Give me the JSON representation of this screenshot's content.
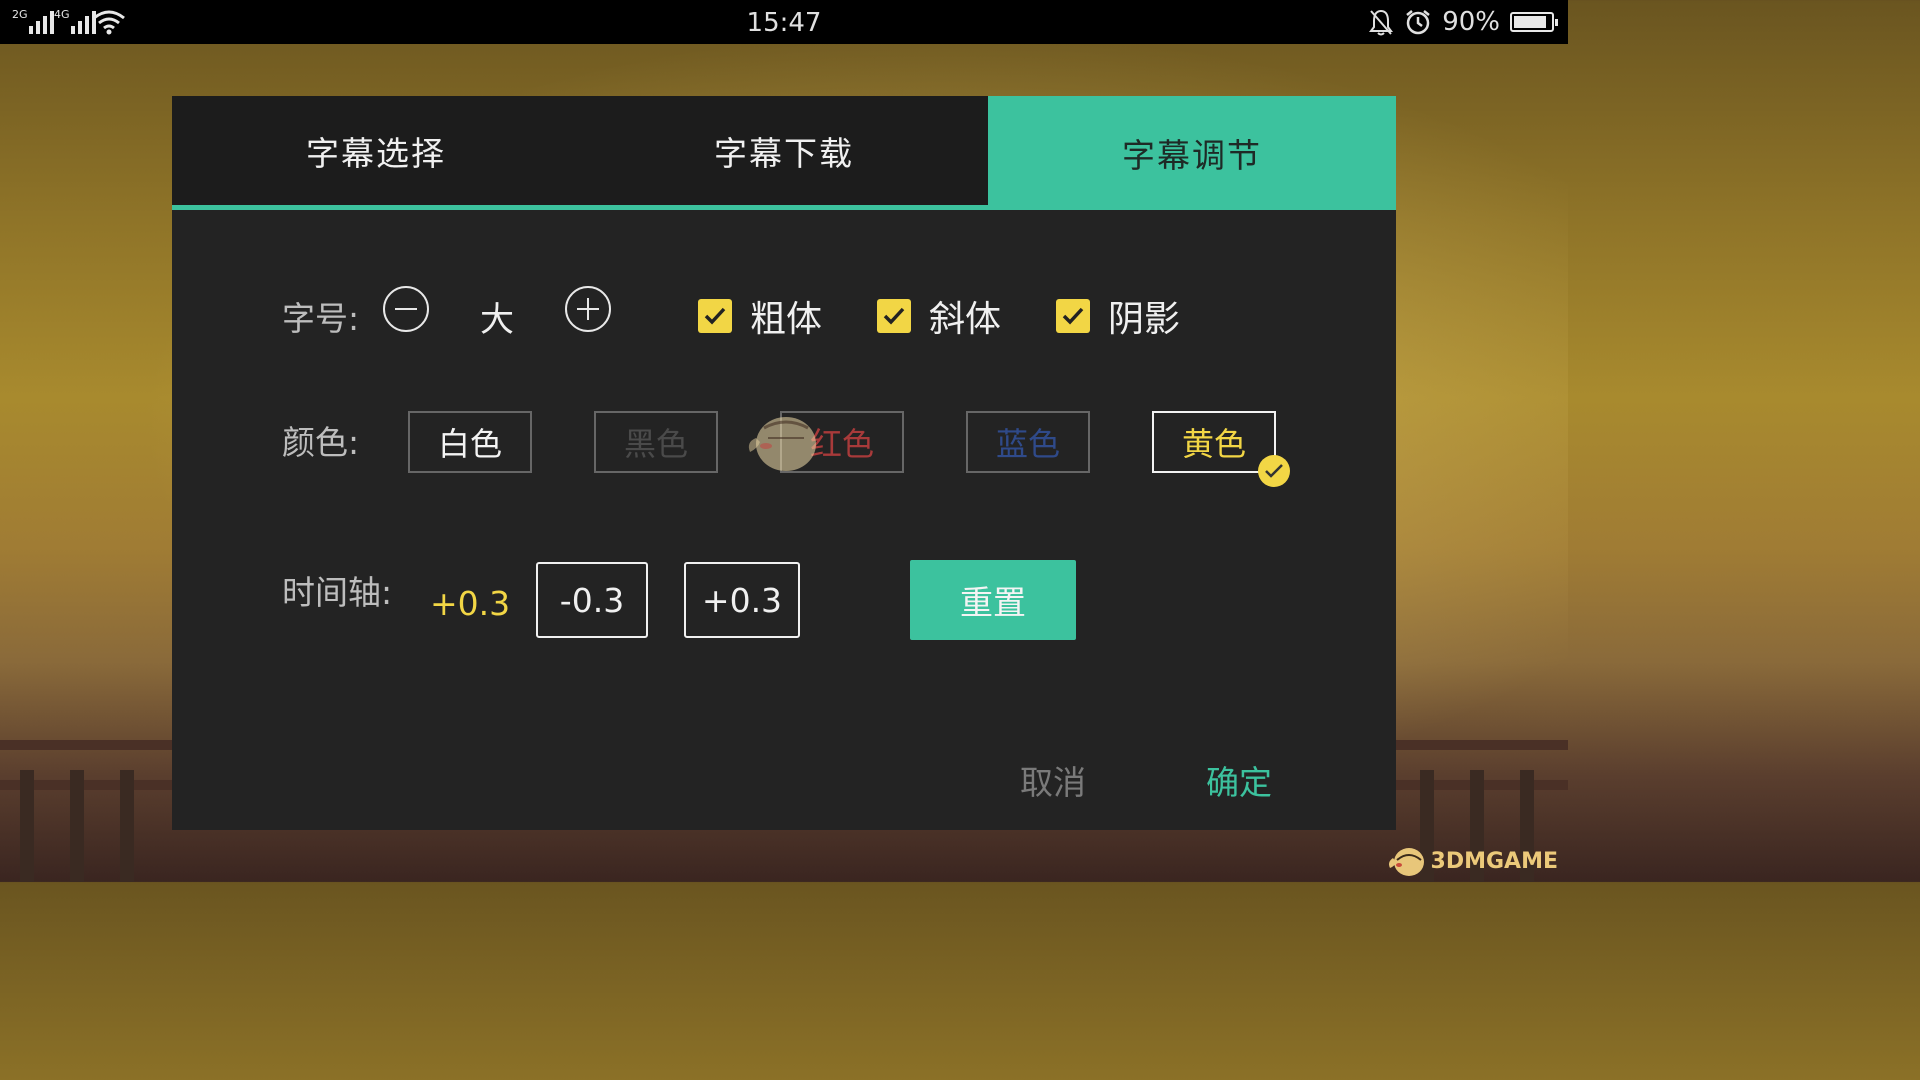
{
  "status_bar": {
    "network_1": "2G",
    "network_2": "4G",
    "time": "15:47",
    "battery_percent": "90%",
    "battery_level": 0.9,
    "icons": [
      "signal-icon",
      "wifi-icon",
      "bell-off-icon",
      "alarm-icon",
      "battery-icon"
    ]
  },
  "tabs": [
    {
      "label": "字幕选择",
      "active": false
    },
    {
      "label": "字幕下载",
      "active": false
    },
    {
      "label": "字幕调节",
      "active": true
    }
  ],
  "font_size": {
    "label": "字号:",
    "value": "大"
  },
  "styles": [
    {
      "label": "粗体",
      "checked": true
    },
    {
      "label": "斜体",
      "checked": true
    },
    {
      "label": "阴影",
      "checked": true
    }
  ],
  "color": {
    "label": "颜色:",
    "options": [
      {
        "label": "白色",
        "text_color": "#f4f4f4",
        "selected": false
      },
      {
        "label": "黑色",
        "text_color": "#4a4a4a",
        "selected": false
      },
      {
        "label": "红色",
        "text_color": "#a83a3a",
        "selected": false
      },
      {
        "label": "蓝色",
        "text_color": "#2f4a8a",
        "selected": false
      },
      {
        "label": "黄色",
        "text_color": "#f2d645",
        "selected": true
      }
    ]
  },
  "timeline": {
    "label": "时间轴:",
    "offset": "+0.3",
    "minus_label": "-0.3",
    "plus_label": "+0.3",
    "reset_label": "重置"
  },
  "footer": {
    "cancel_label": "取消",
    "confirm_label": "确定"
  },
  "colors": {
    "accent": "#3cc29e",
    "checkbox": "#f2d645",
    "dialog_bg": "#232323"
  },
  "watermark": {
    "brand": "3DMGAME"
  }
}
